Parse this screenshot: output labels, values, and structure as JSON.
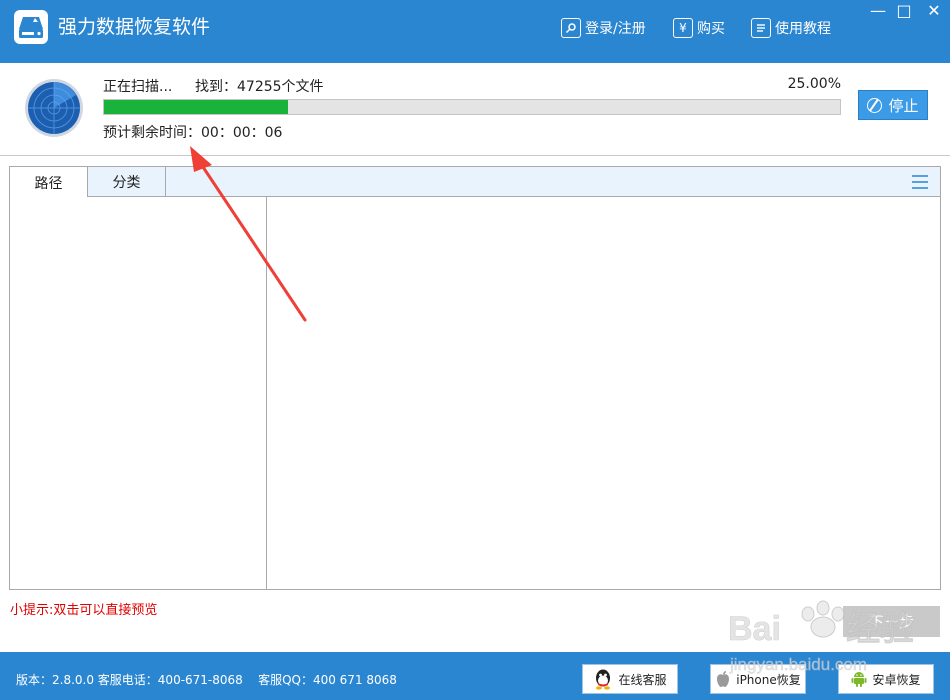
{
  "app": {
    "title": "强力数据恢复软件",
    "nav": {
      "login": "登录/注册",
      "buy": "购买",
      "tutorial": "使用教程"
    },
    "window": {
      "minimize": "—",
      "maximize": "□",
      "close": "✕"
    }
  },
  "scan": {
    "status": "正在扫描...",
    "found": "找到：47255个文件",
    "progress_percent": "25.00%",
    "progress_fraction": 0.25,
    "remaining": "预计剩余时间：00：00：06",
    "stop_label": "停止"
  },
  "tabs": [
    "路径",
    "分类"
  ],
  "tip": "小提示:双击可以直接预览",
  "next_label": "下一步",
  "footer": {
    "info": "版本：2.8.0.0 客服电话：400-671-8068    客服QQ：400 671 8068",
    "online_service": "在线客服",
    "iphone_recovery": "iPhone恢复",
    "android_recovery": "安卓恢复"
  },
  "watermark": "Baidu 经验 jingyan.baidu.com",
  "colors": {
    "brand": "#2b86d2",
    "progress": "#19b23b",
    "tip": "#e00000",
    "arrow": "#ee4035"
  },
  "icons": [
    "logo-disk-icon",
    "key-icon",
    "yen-icon",
    "doc-icon",
    "radar-icon",
    "stop-icon",
    "menu-icon",
    "qq-icon",
    "apple-icon",
    "android-icon"
  ]
}
